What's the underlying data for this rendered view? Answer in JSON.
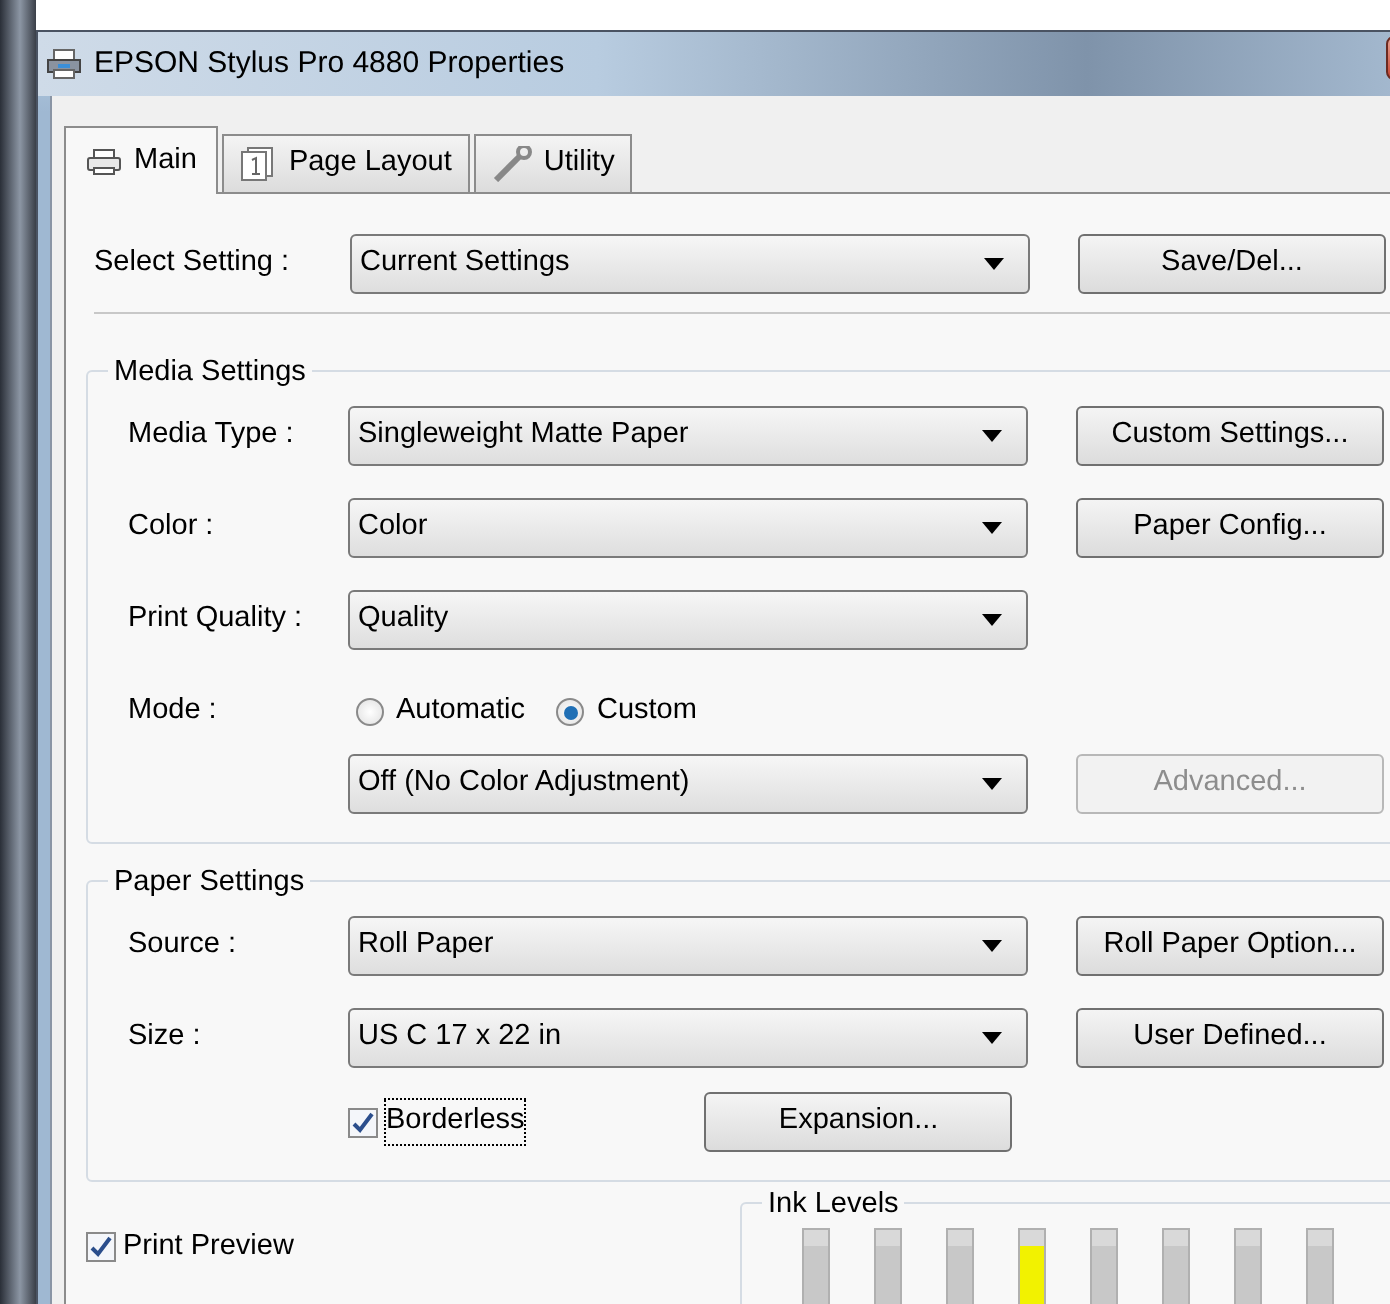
{
  "window": {
    "title": "EPSON Stylus Pro 4880 Properties"
  },
  "tabs": [
    {
      "label": "Main",
      "selected": true
    },
    {
      "label": "Page Layout",
      "selected": false
    },
    {
      "label": "Utility",
      "selected": false
    }
  ],
  "select_setting": {
    "label": "Select Setting :",
    "value": "Current Settings",
    "button": "Save/Del..."
  },
  "media_settings": {
    "title": "Media Settings",
    "rows": [
      {
        "label": "Media Type :",
        "value": "Singleweight Matte Paper",
        "button": "Custom Settings..."
      },
      {
        "label": "Color :",
        "value": "Color",
        "button": "Paper Config..."
      },
      {
        "label": "Print Quality :",
        "value": "Quality"
      }
    ],
    "mode": {
      "label": "Mode :",
      "options": [
        {
          "label": "Automatic",
          "selected": false
        },
        {
          "label": "Custom",
          "selected": true
        }
      ],
      "value": "Off (No Color Adjustment)",
      "button": {
        "label": "Advanced...",
        "disabled": true
      }
    }
  },
  "paper_settings": {
    "title": "Paper Settings",
    "rows": [
      {
        "label": "Source :",
        "value": "Roll Paper",
        "button": "Roll Paper Option..."
      },
      {
        "label": "Size :",
        "value": "US C 17 x 22 in",
        "button": "User Defined..."
      }
    ],
    "borderless": {
      "label": "Borderless",
      "checked": true
    },
    "button": "Expansion..."
  },
  "print_preview": {
    "label": "Print Preview",
    "checked": true
  },
  "ink_levels": {
    "title": "Ink Levels",
    "inks": [
      {
        "color": "#c8c8c8"
      },
      {
        "color": "#c8c8c8"
      },
      {
        "color": "#c8c8c8"
      },
      {
        "color": "#f2f200"
      },
      {
        "color": "#c8c8c8"
      },
      {
        "color": "#c8c8c8"
      },
      {
        "color": "#c8c8c8"
      },
      {
        "color": "#c8c8c8"
      }
    ]
  }
}
